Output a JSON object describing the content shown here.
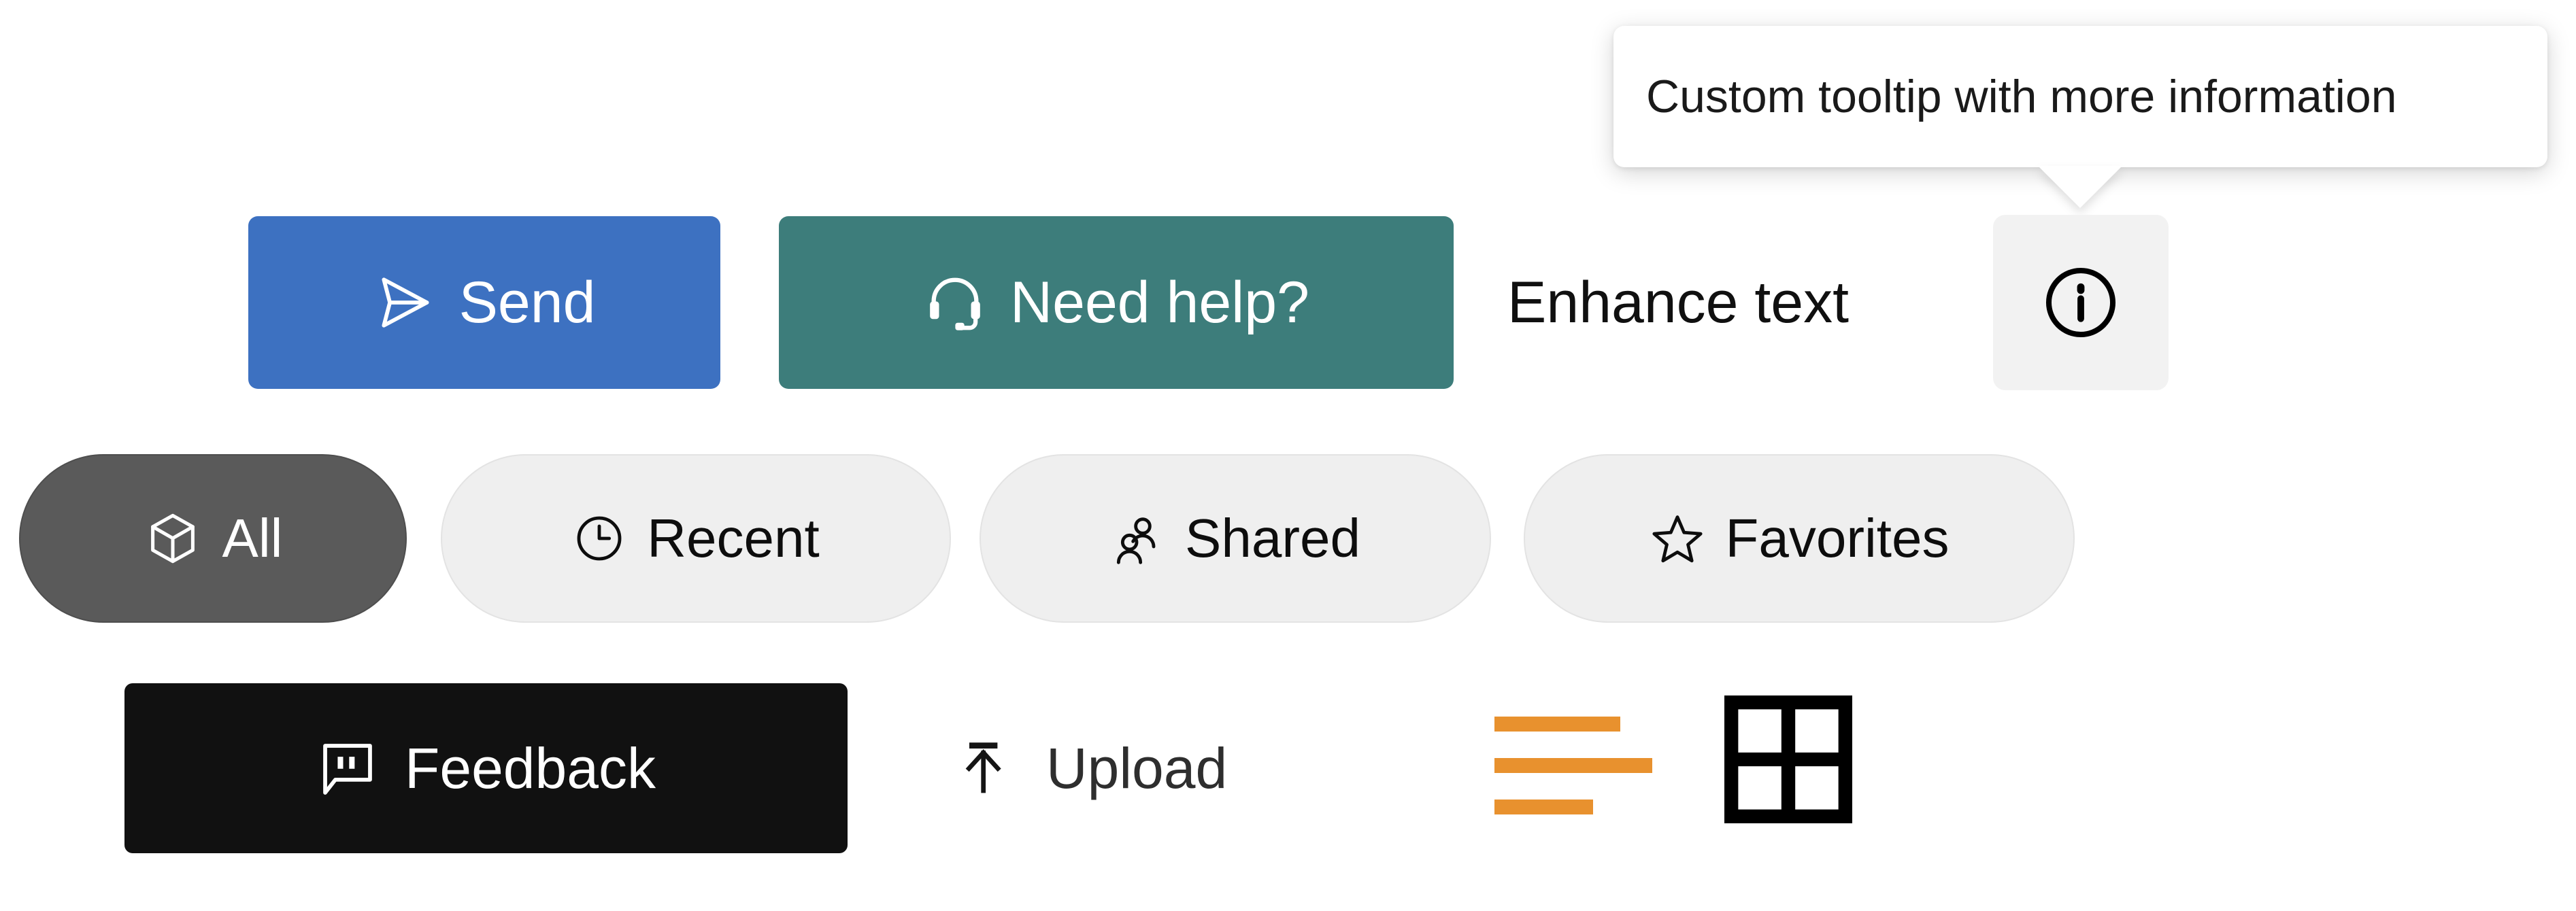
{
  "colors": {
    "send_bg": "#3d71c1",
    "need_help_bg": "#3d7d7b",
    "feedback_bg": "#111111",
    "pill_active_bg": "#5a5a5a",
    "pill_inactive_bg": "#efefef",
    "info_button_bg": "#f2f2f2",
    "list_icon_orange": "#e8912e",
    "grid_icon_black": "#000000",
    "tooltip_bg": "#ffffff",
    "page_bg": "#ffffff",
    "text_dark": "#101010",
    "upload_text": "#2e2e2e"
  },
  "tooltip": {
    "text": "Custom tooltip with more information",
    "anchor": "info-button",
    "placement": "top"
  },
  "action_row": {
    "send": {
      "label": "Send",
      "icon": "send-icon"
    },
    "need_help": {
      "label": "Need help?",
      "icon": "headset-icon"
    },
    "enhance": {
      "label": "Enhance text",
      "info_icon": "info-circle-icon"
    }
  },
  "filter_pills": {
    "items": [
      {
        "label": "All",
        "icon": "cube-icon",
        "active": true
      },
      {
        "label": "Recent",
        "icon": "clock-icon",
        "active": false
      },
      {
        "label": "Shared",
        "icon": "people-icon",
        "active": false
      },
      {
        "label": "Favorites",
        "icon": "star-icon",
        "active": false
      }
    ]
  },
  "bottom_row": {
    "feedback": {
      "label": "Feedback",
      "icon": "comment-quote-icon"
    },
    "upload": {
      "label": "Upload",
      "icon": "arrow-up-to-line-icon"
    },
    "view_toggles": {
      "list": {
        "icon": "list-view-icon"
      },
      "grid": {
        "icon": "grid-view-icon"
      }
    }
  }
}
